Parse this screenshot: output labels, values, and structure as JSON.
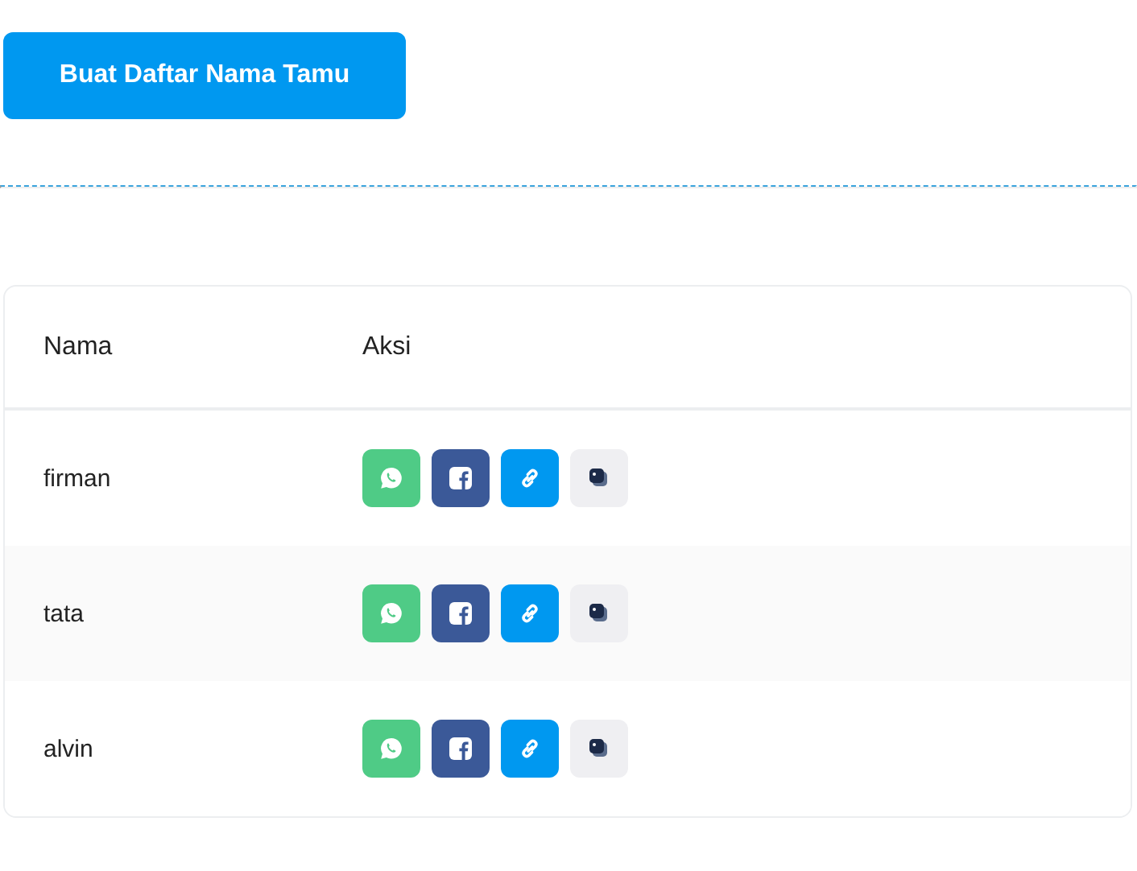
{
  "create_button": {
    "label": "Buat Daftar Nama Tamu"
  },
  "table": {
    "columns": [
      "Nama",
      "Aksi"
    ],
    "rows": [
      {
        "name": "firman"
      },
      {
        "name": "tata"
      },
      {
        "name": "alvin"
      }
    ]
  }
}
